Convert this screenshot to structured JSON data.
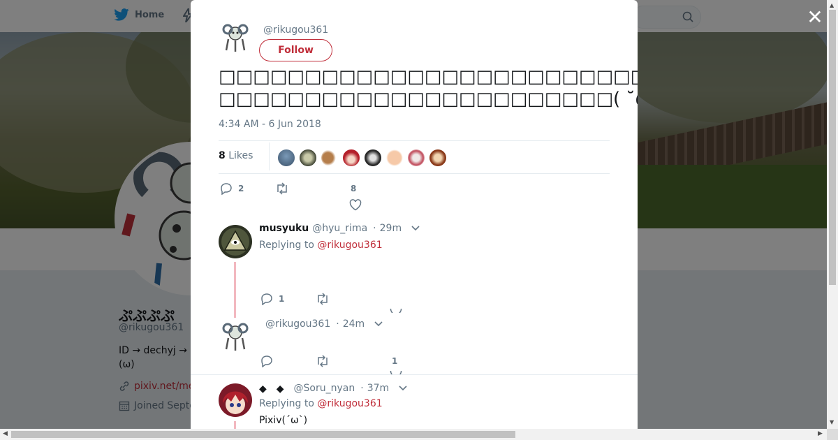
{
  "nav": {
    "home_label": "Home"
  },
  "profile": {
    "name": "ぷぷぷぷ",
    "handle": "@rikugou361",
    "bio": "ID → dechyj  → (ω)",
    "link": "pixiv.net/me",
    "joined": "Joined Septe"
  },
  "modal": {
    "author_handle": "@rikugou361",
    "follow_label": "Follow",
    "tweet_text_line1": "□□□□□□□□□□□□□□□□□□□□□□□□□□□□□□□□□□□□□□□□□□□□□□□□",
    "tweet_text_line2": "□□□□□□□□□□□□□□□□□□□□□□□( ˘ω˘)",
    "timestamp": "4:34 AM - 6 Jun 2018",
    "likes_count": "8",
    "likes_label": " Likes",
    "actions": {
      "reply_count": "2",
      "retweet_count": "",
      "like_count": "8"
    }
  },
  "replies": [
    {
      "name": "musyuku",
      "handle": "@hyu_rima",
      "time": "29m",
      "replying_prefix": "Replying to ",
      "replying_to": "@rikugou361",
      "text": "",
      "reply_count": "1",
      "like_count": ""
    },
    {
      "name": "",
      "handle": "@rikugou361",
      "time": "24m",
      "text": "",
      "reply_count": "",
      "like_count": "1"
    },
    {
      "name": "◆　◆",
      "handle": "@Soru_nyan",
      "time": "37m",
      "replying_prefix": "Replying to ",
      "replying_to": "@rikugou361",
      "text": "Pixiv(´ω`)"
    }
  ],
  "colors": {
    "accent": "#c02e3a",
    "twitter_blue": "#1da1f2",
    "muted": "#657786"
  }
}
